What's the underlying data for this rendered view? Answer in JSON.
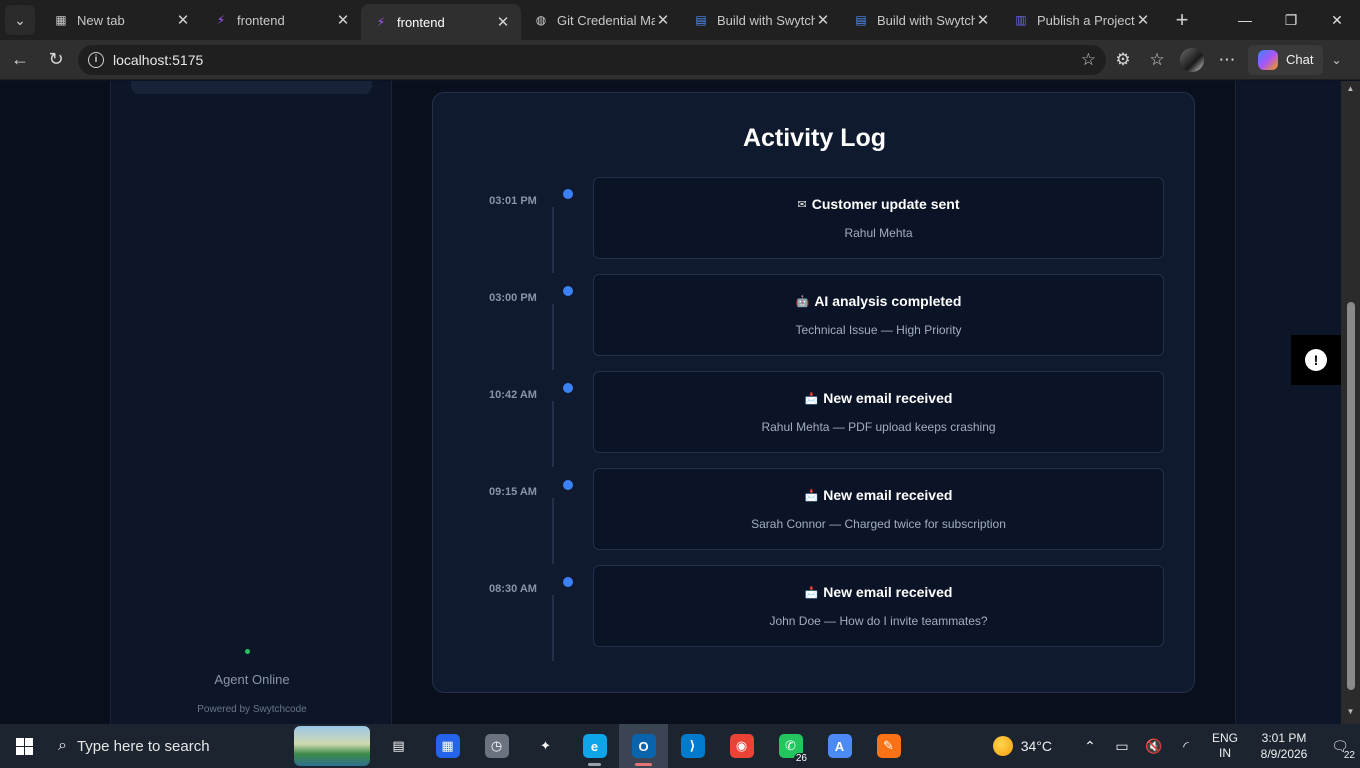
{
  "browser": {
    "tabs": [
      {
        "title": "New tab",
        "icon": "grid-icon",
        "color": "#c8c8c8",
        "active": false
      },
      {
        "title": "frontend",
        "icon": "vite-icon",
        "color": "#a855f7",
        "active": false
      },
      {
        "title": "frontend",
        "icon": "vite-icon",
        "color": "#a855f7",
        "active": true
      },
      {
        "title": "Git Credential Man",
        "icon": "globe-icon",
        "color": "#d0d0d0",
        "active": false
      },
      {
        "title": "Build with Swytchc",
        "icon": "docs-icon",
        "color": "#4c8bf5",
        "active": false
      },
      {
        "title": "Build with Swytchc",
        "icon": "docs-icon",
        "color": "#4c8bf5",
        "active": false
      },
      {
        "title": "Publish a Project -",
        "icon": "publish-icon",
        "color": "#6366f1",
        "active": false
      }
    ],
    "url": "localhost:5175",
    "chat_label": "Chat"
  },
  "page": {
    "panel_title": "Activity Log",
    "sidebar": {
      "status_text": "Agent Online",
      "powered_by": "Powered by Swytchcode",
      "status_color": "#22c55e"
    },
    "accent_color": "#3b82f6",
    "activities": [
      {
        "time": "03:01 PM",
        "icon": "mail-icon",
        "glyph": "✉",
        "title": "Customer update sent",
        "subtitle": "Rahul Mehta"
      },
      {
        "time": "03:00 PM",
        "icon": "robot-icon",
        "glyph": "🤖",
        "title": "AI analysis completed",
        "subtitle": "Technical Issue — High Priority"
      },
      {
        "time": "10:42 AM",
        "icon": "incoming-mail-icon",
        "glyph": "📩",
        "title": "New email received",
        "subtitle": "Rahul Mehta — PDF upload keeps crashing"
      },
      {
        "time": "09:15 AM",
        "icon": "incoming-mail-icon",
        "glyph": "📩",
        "title": "New email received",
        "subtitle": "Sarah Connor — Charged twice for subscription"
      },
      {
        "time": "08:30 AM",
        "icon": "incoming-mail-icon",
        "glyph": "📩",
        "title": "New email received",
        "subtitle": "John Doe — How do I invite teammates?"
      }
    ]
  },
  "taskbar": {
    "search_placeholder": "Type here to search",
    "apps": [
      {
        "name": "task-view-icon",
        "glyph": "▤",
        "bg": "transparent",
        "running": false,
        "active": false
      },
      {
        "name": "microsoft-store-icon",
        "glyph": "▦",
        "bg": "#2563eb",
        "running": false,
        "active": false
      },
      {
        "name": "clock-app-icon",
        "glyph": "◷",
        "bg": "#6b7280",
        "running": false,
        "active": false
      },
      {
        "name": "feather-app-icon",
        "glyph": "✦",
        "bg": "transparent",
        "running": false,
        "active": false
      },
      {
        "name": "edge-icon",
        "glyph": "e",
        "bg": "#0ea5e9",
        "running": true,
        "active": false
      },
      {
        "name": "outlook-icon",
        "glyph": "O",
        "bg": "#0a64ad",
        "running": true,
        "active": true
      },
      {
        "name": "vscode-icon",
        "glyph": "⟩",
        "bg": "#007acc",
        "running": false,
        "active": false
      },
      {
        "name": "chrome-icon",
        "glyph": "◉",
        "bg": "#ea4335",
        "running": false,
        "active": false
      },
      {
        "name": "whatsapp-icon",
        "glyph": "✆",
        "bg": "#22c55e",
        "running": false,
        "active": false,
        "badge": "26"
      },
      {
        "name": "arc-app-icon",
        "glyph": "A",
        "bg": "#4c8bf5",
        "running": false,
        "active": false
      },
      {
        "name": "postman-icon",
        "glyph": "✎",
        "bg": "#f97316",
        "running": false,
        "active": false
      }
    ],
    "weather": "34°C",
    "lang_line1": "ENG",
    "lang_line2": "IN",
    "time": "3:01 PM",
    "date": "8/9/2026",
    "notification_count": "22"
  }
}
